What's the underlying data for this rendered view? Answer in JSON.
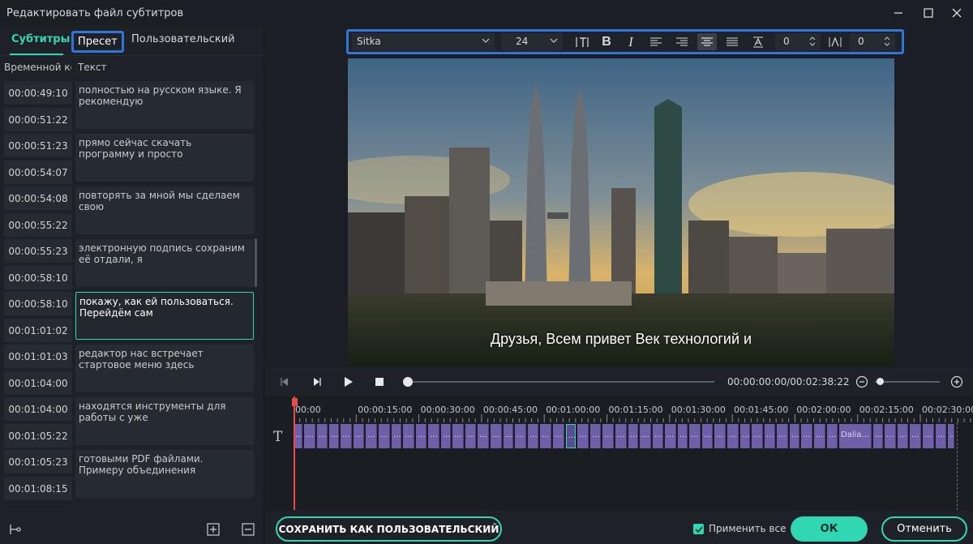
{
  "window": {
    "title": "Редактировать файл субтитров"
  },
  "tabs": {
    "subtitles": "Субтитры",
    "preset": "Пресет",
    "custom": "Пользовательский"
  },
  "columns": {
    "time": "Временной код",
    "text": "Текст"
  },
  "rows": [
    {
      "start": "00:00:49:10",
      "end": "00:00:51:22",
      "text": "полностью на русском языке. Я рекомендую",
      "selected": false
    },
    {
      "start": "00:00:51:23",
      "end": "00:00:54:07",
      "text": "прямо сейчас скачать программу и просто",
      "selected": false
    },
    {
      "start": "00:00:54:08",
      "end": "00:00:55:22",
      "text": "повторять за мной мы сделаем свою",
      "selected": false
    },
    {
      "start": "00:00:55:23",
      "end": "00:00:58:10",
      "text": "электронную подпись сохраним её отдали, я",
      "selected": false
    },
    {
      "start": "00:00:58:10",
      "end": "00:01:01:02",
      "text": "покажу, как ей пользоваться. Перейдём сам",
      "selected": true
    },
    {
      "start": "00:01:01:03",
      "end": "00:01:04:00",
      "text": "редактор нас встречает стартовое меню здесь",
      "selected": false
    },
    {
      "start": "00:01:04:00",
      "end": "00:01:05:22",
      "text": "находятся инструменты для работы с уже",
      "selected": false
    },
    {
      "start": "00:01:05:23",
      "end": "00:01:08:15",
      "text": "готовыми PDF файлами. Примеру объединения",
      "selected": false
    }
  ],
  "toolbar": {
    "font": "Sitka",
    "size": "24",
    "line_spacing": "0",
    "letter_spacing": "0",
    "active_align": "center"
  },
  "video": {
    "subtitle": "Друзья, Всем привет Век технологий и"
  },
  "playback": {
    "timecode": "00:00:00:00/00:02:38:22",
    "progress": 0
  },
  "timeline": {
    "ruler": [
      "00:00",
      "00:00:15:00",
      "00:00:30:00",
      "00:00:45:00",
      "00:01:00:00",
      "00:01:15:00",
      "00:01:30:00",
      "00:01:45:00",
      "00:02:00:00",
      "00:02:15:00",
      "00:02:30:00"
    ],
    "clip_label": "Dalia...",
    "clip_dots": "..."
  },
  "bottom": {
    "save_custom": "СОХРАНИТЬ КАК ПОЛЬЗОВАТЕЛЬСКИЙ",
    "apply_all": "Применить все",
    "apply_all_checked": true,
    "ok": "ОК",
    "cancel": "Отменить"
  },
  "colors": {
    "accent": "#31d6b2",
    "highlight": "#2f76d6",
    "clip": "#6f5ea8",
    "playhead": "#e94b4b"
  }
}
